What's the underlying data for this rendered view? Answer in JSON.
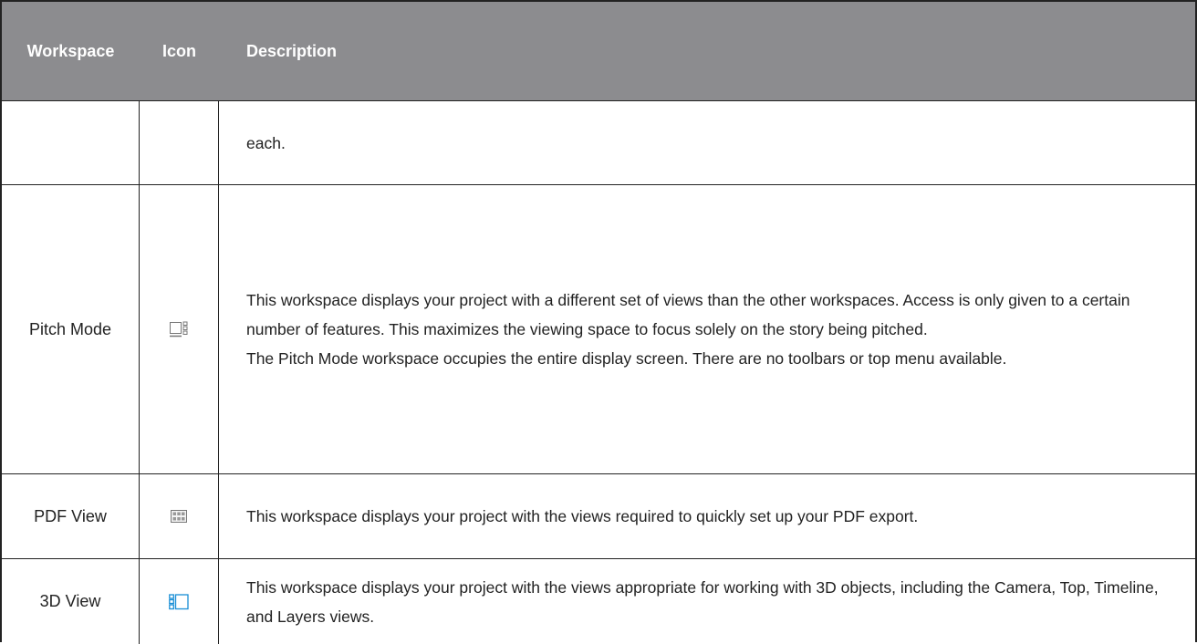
{
  "table": {
    "headers": {
      "workspace": "Workspace",
      "icon": "Icon",
      "description": "Description"
    },
    "rows": [
      {
        "workspace": "",
        "icon": "",
        "description": [
          "each."
        ]
      },
      {
        "workspace": "Pitch Mode",
        "icon": "pitch-mode-icon",
        "description": [
          "This workspace displays your project with a different set of views than the other workspaces. Access is only given to a certain number of features. This maximizes the viewing space to focus solely on the story being pitched.",
          "The Pitch Mode workspace occupies the entire display screen. There are no toolbars or top menu available."
        ]
      },
      {
        "workspace": "PDF View",
        "icon": "pdf-view-icon",
        "description": [
          "This workspace displays your project with the views required to quickly set up your PDF export."
        ]
      },
      {
        "workspace": "3D View",
        "icon": "3d-view-icon",
        "description": [
          "This workspace displays your project with the views appropriate for working with 3D objects, including the Camera, Top, Timeline, and Layers views."
        ]
      }
    ]
  },
  "colors": {
    "header_bg": "#8c8c8f",
    "header_text": "#ffffff",
    "border": "#222222",
    "icon_blue": "#1a8fd6"
  }
}
